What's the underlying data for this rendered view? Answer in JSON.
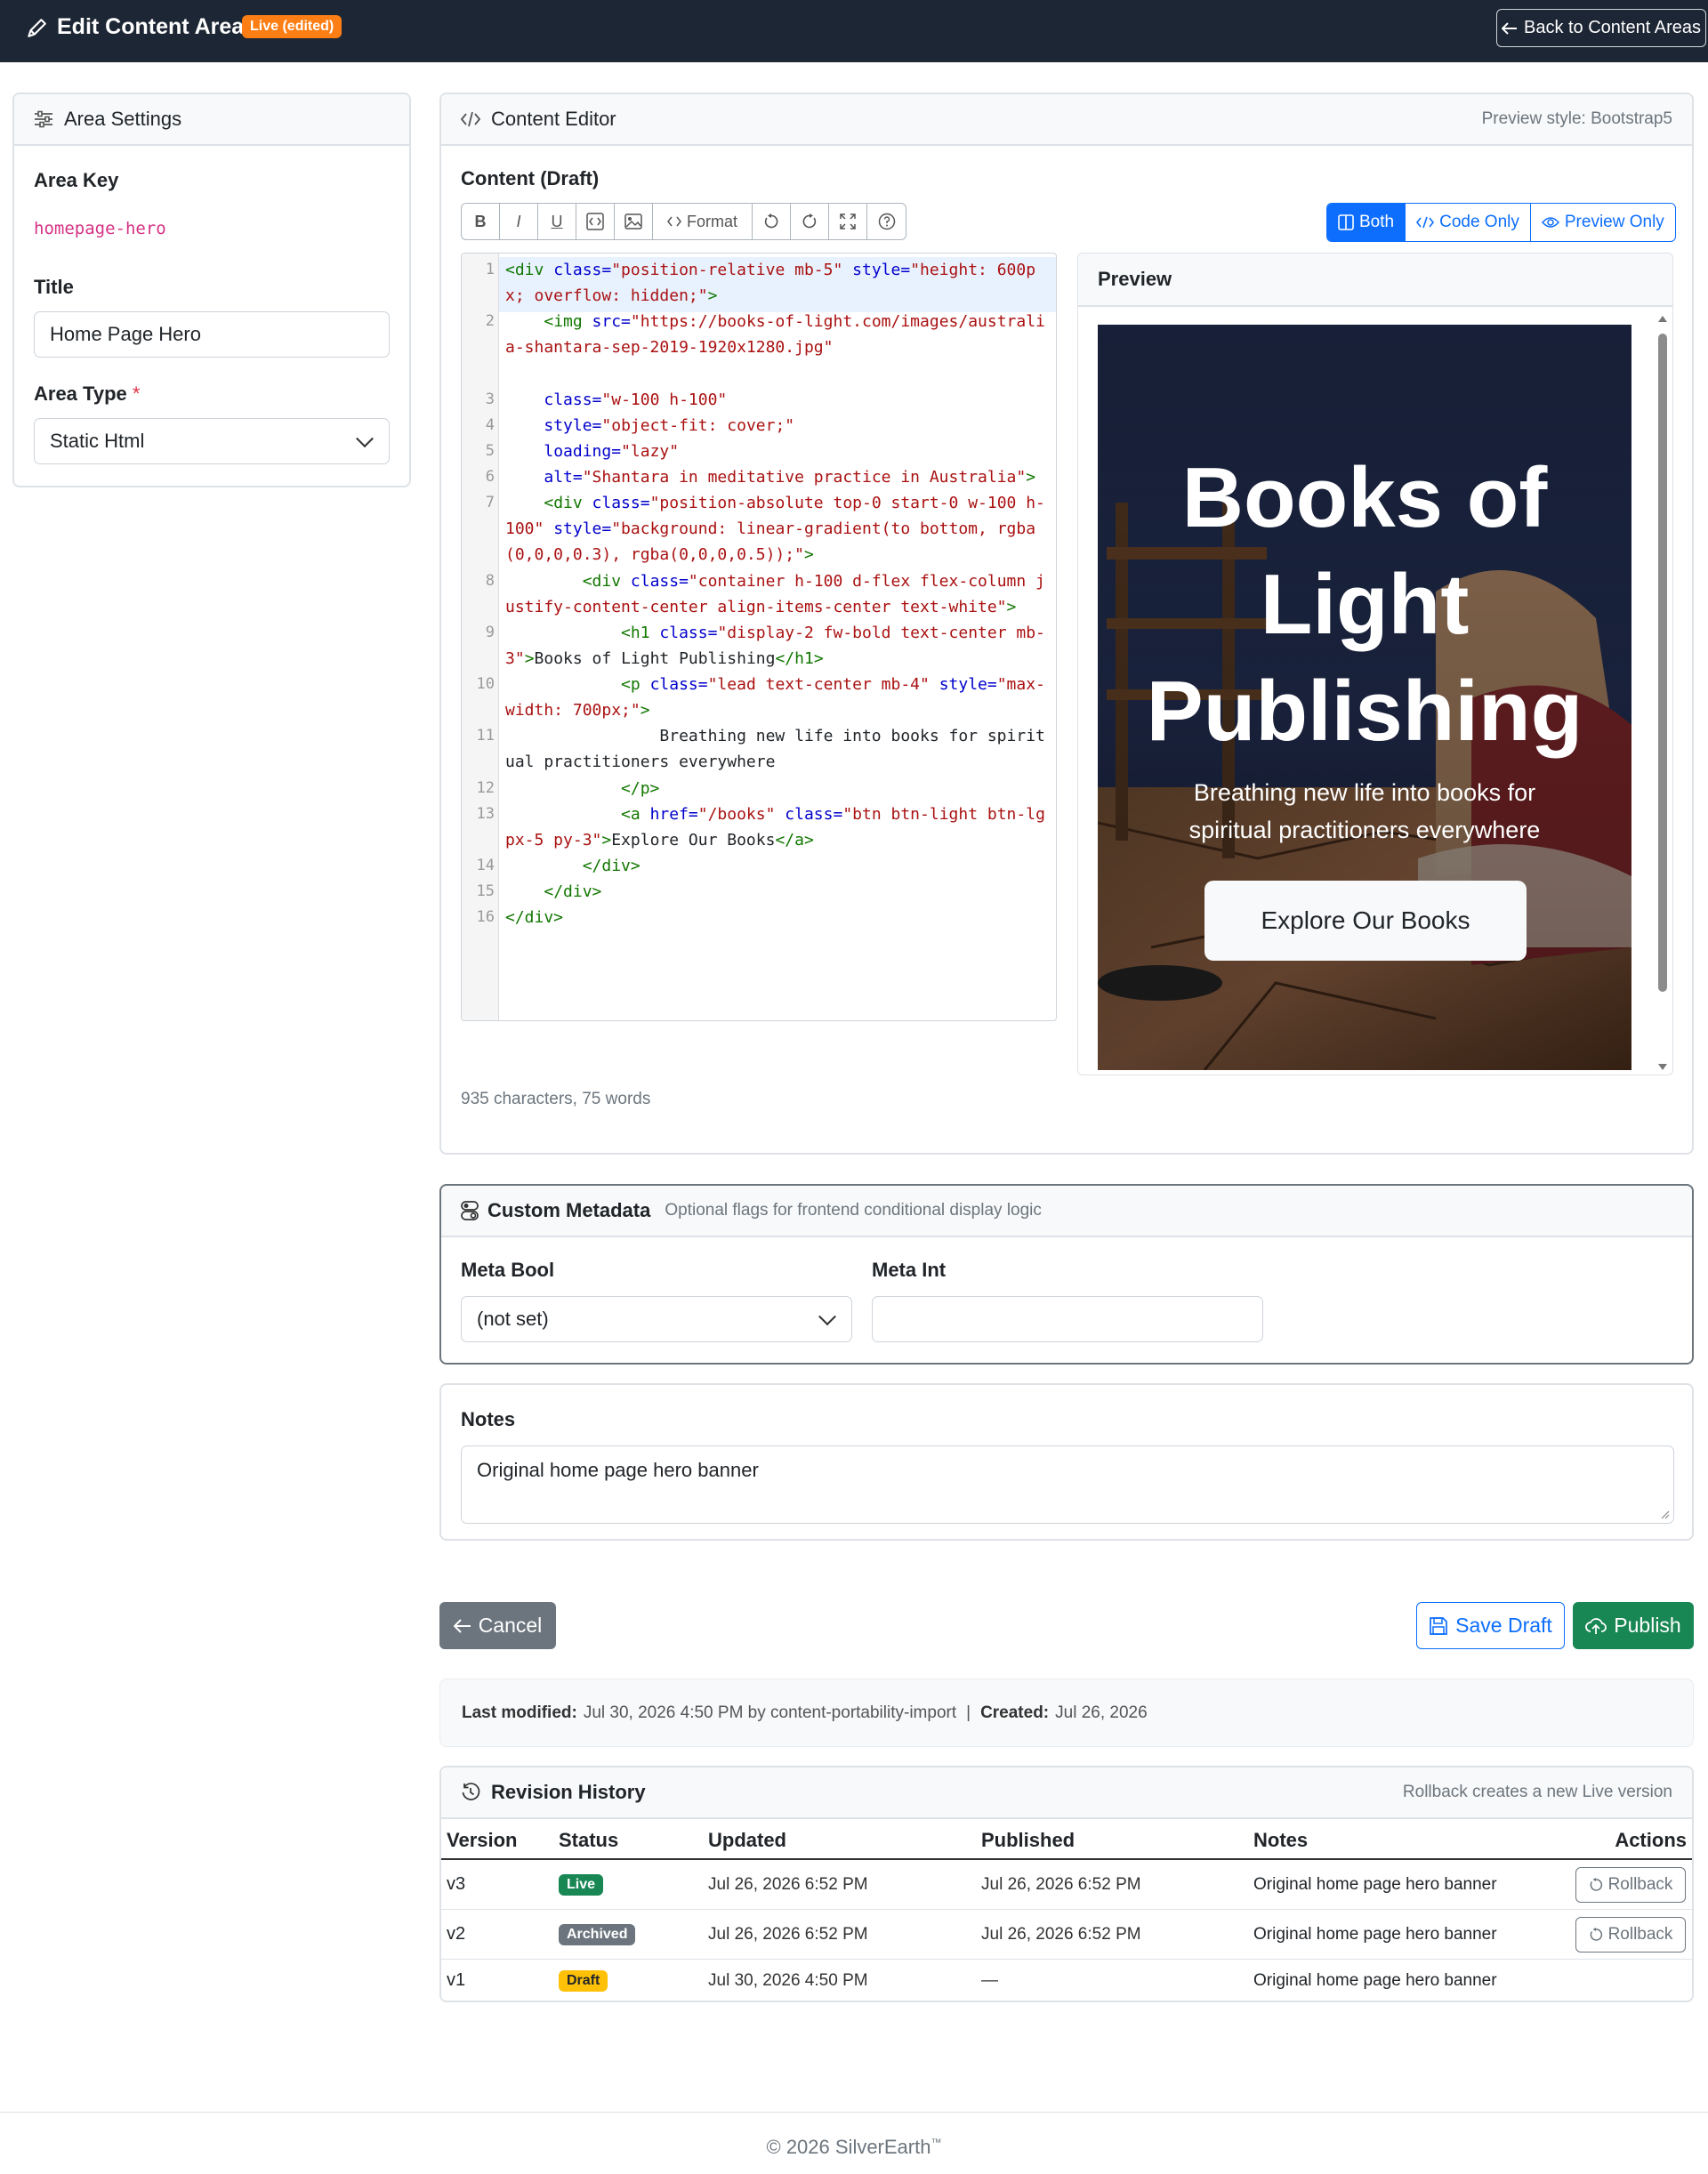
{
  "topbar": {
    "title": "Edit Content Area",
    "badge": "Live (edited)",
    "back_label": "Back to Content Areas",
    "bg_color": "#1d2634",
    "badge_color": "#fd7e14"
  },
  "area_settings": {
    "header": "Area Settings",
    "area_key_label": "Area Key",
    "area_key_value": "homepage-hero",
    "title_label": "Title",
    "title_value": "Home Page Hero",
    "area_type_label": "Area Type",
    "required_mark": "*",
    "area_type_value": "Static Html"
  },
  "content_editor": {
    "header": "Content Editor",
    "preview_style": "Preview style: Bootstrap5",
    "content_label": "Content (Draft)",
    "toolbar": {
      "bold": "B",
      "italic": "I",
      "underline": "U",
      "format": "Format"
    },
    "view_modes": {
      "both": "Both",
      "code_only": "Code Only",
      "preview_only": "Preview Only"
    },
    "active_view": "both",
    "line_numbers": [
      "1",
      "2",
      "3",
      "4",
      "5",
      "6",
      "7",
      "8",
      "9",
      "10",
      "11",
      "12",
      "13",
      "14",
      "15",
      "16"
    ],
    "stats": "935 characters, 75 words"
  },
  "preview": {
    "header": "Preview",
    "hero_title": "Books of Light Publishing",
    "hero_lead": "Breathing new life into books for spiritual practitioners everywhere",
    "hero_button": "Explore Our Books"
  },
  "custom_metadata": {
    "header": "Custom Metadata",
    "subtitle": "Optional flags for frontend conditional display logic",
    "meta_bool_label": "Meta Bool",
    "meta_bool_value": "(not set)",
    "meta_int_label": "Meta Int",
    "meta_int_value": ""
  },
  "notes": {
    "label": "Notes",
    "value": "Original home page hero banner"
  },
  "actions": {
    "cancel": "Cancel",
    "save_draft": "Save Draft",
    "publish": "Publish"
  },
  "meta_info": {
    "last_modified_label": "Last modified:",
    "last_modified_value": "Jul 30, 2026 4:50 PM by content-portability-import",
    "separator": "|",
    "created_label": "Created:",
    "created_value": "Jul 26, 2026"
  },
  "revision_history": {
    "header": "Revision History",
    "note": "Rollback creates a new Live version",
    "columns": [
      "Version",
      "Status",
      "Updated",
      "Published",
      "Notes",
      "Actions"
    ],
    "rows": [
      {
        "version": "v3",
        "status": "Live",
        "status_color": "#198754",
        "updated": "Jul 26, 2026 6:52 PM",
        "published": "Jul 26, 2026 6:52 PM",
        "notes": "Original home page hero banner",
        "action": "Rollback"
      },
      {
        "version": "v2",
        "status": "Archived",
        "status_color": "#6c757d",
        "updated": "Jul 26, 2026 6:52 PM",
        "published": "Jul 26, 2026 6:52 PM",
        "notes": "Original home page hero banner",
        "action": "Rollback"
      },
      {
        "version": "v1",
        "status": "Draft",
        "status_color": "#ffc107",
        "updated": "Jul 30, 2026 4:50 PM",
        "published": "—",
        "notes": "Original home page hero banner",
        "action": ""
      }
    ]
  },
  "footer": {
    "copyright": "© 2026 SilverEarth",
    "tm": "™"
  },
  "icons": [
    "pencil-icon",
    "arrow-left-icon",
    "sliders-icon",
    "code-icon",
    "columns-icon",
    "eye-icon",
    "toggles-icon",
    "save-icon",
    "cloud-upload-icon",
    "clock-history-icon",
    "undo-icon",
    "redo-icon",
    "fullscreen-icon",
    "help-icon",
    "image-icon"
  ]
}
